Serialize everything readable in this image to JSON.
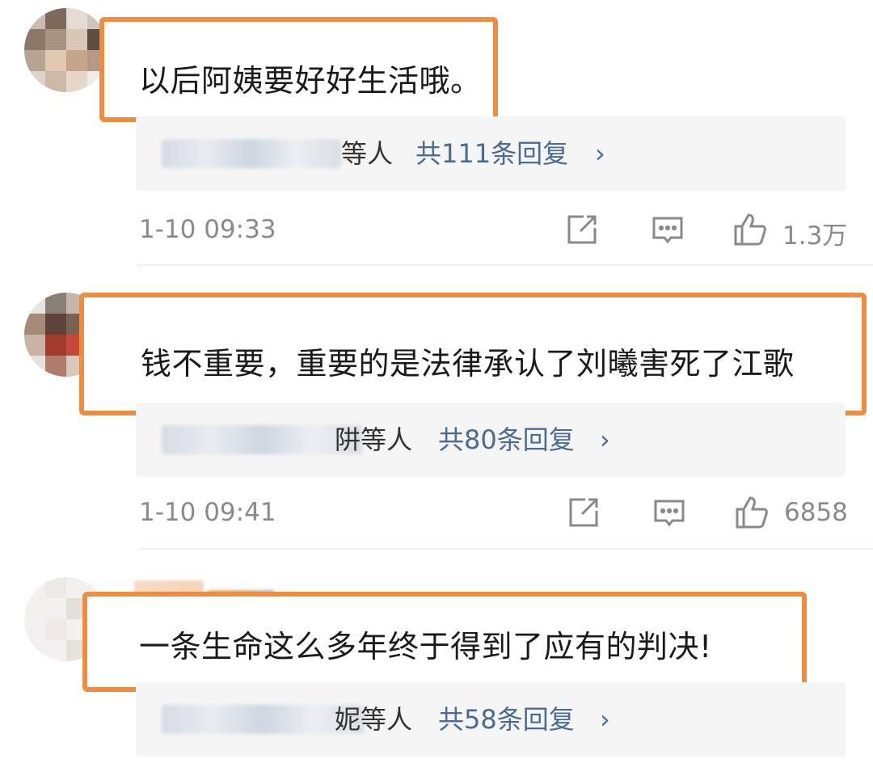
{
  "comments": [
    {
      "text": "以后阿姨要好好生活哦。",
      "reply_suffix": "等人",
      "reply_count": "共111条回复",
      "reply_chevron": "›",
      "time": "1-10 09:33",
      "likes": "1.3万"
    },
    {
      "text": "钱不重要，重要的是法律承认了刘曦害死了江歌",
      "reply_suffix": "阱等人",
      "reply_count": "共80条回复",
      "reply_chevron": "›",
      "time": "1-10 09:41",
      "likes": "6858"
    },
    {
      "text": "一条生命这么多年终于得到了应有的判决!",
      "reply_suffix": "妮等人",
      "reply_count": "共58条回复",
      "reply_chevron": "›"
    }
  ],
  "icons": {
    "share": "share-icon",
    "comment": "comment-icon",
    "like": "thumbs-up-icon"
  },
  "colors": {
    "highlight_border": "#ee8c3f",
    "link": "#4a6b96",
    "meta_gray": "#8a8a8a"
  }
}
